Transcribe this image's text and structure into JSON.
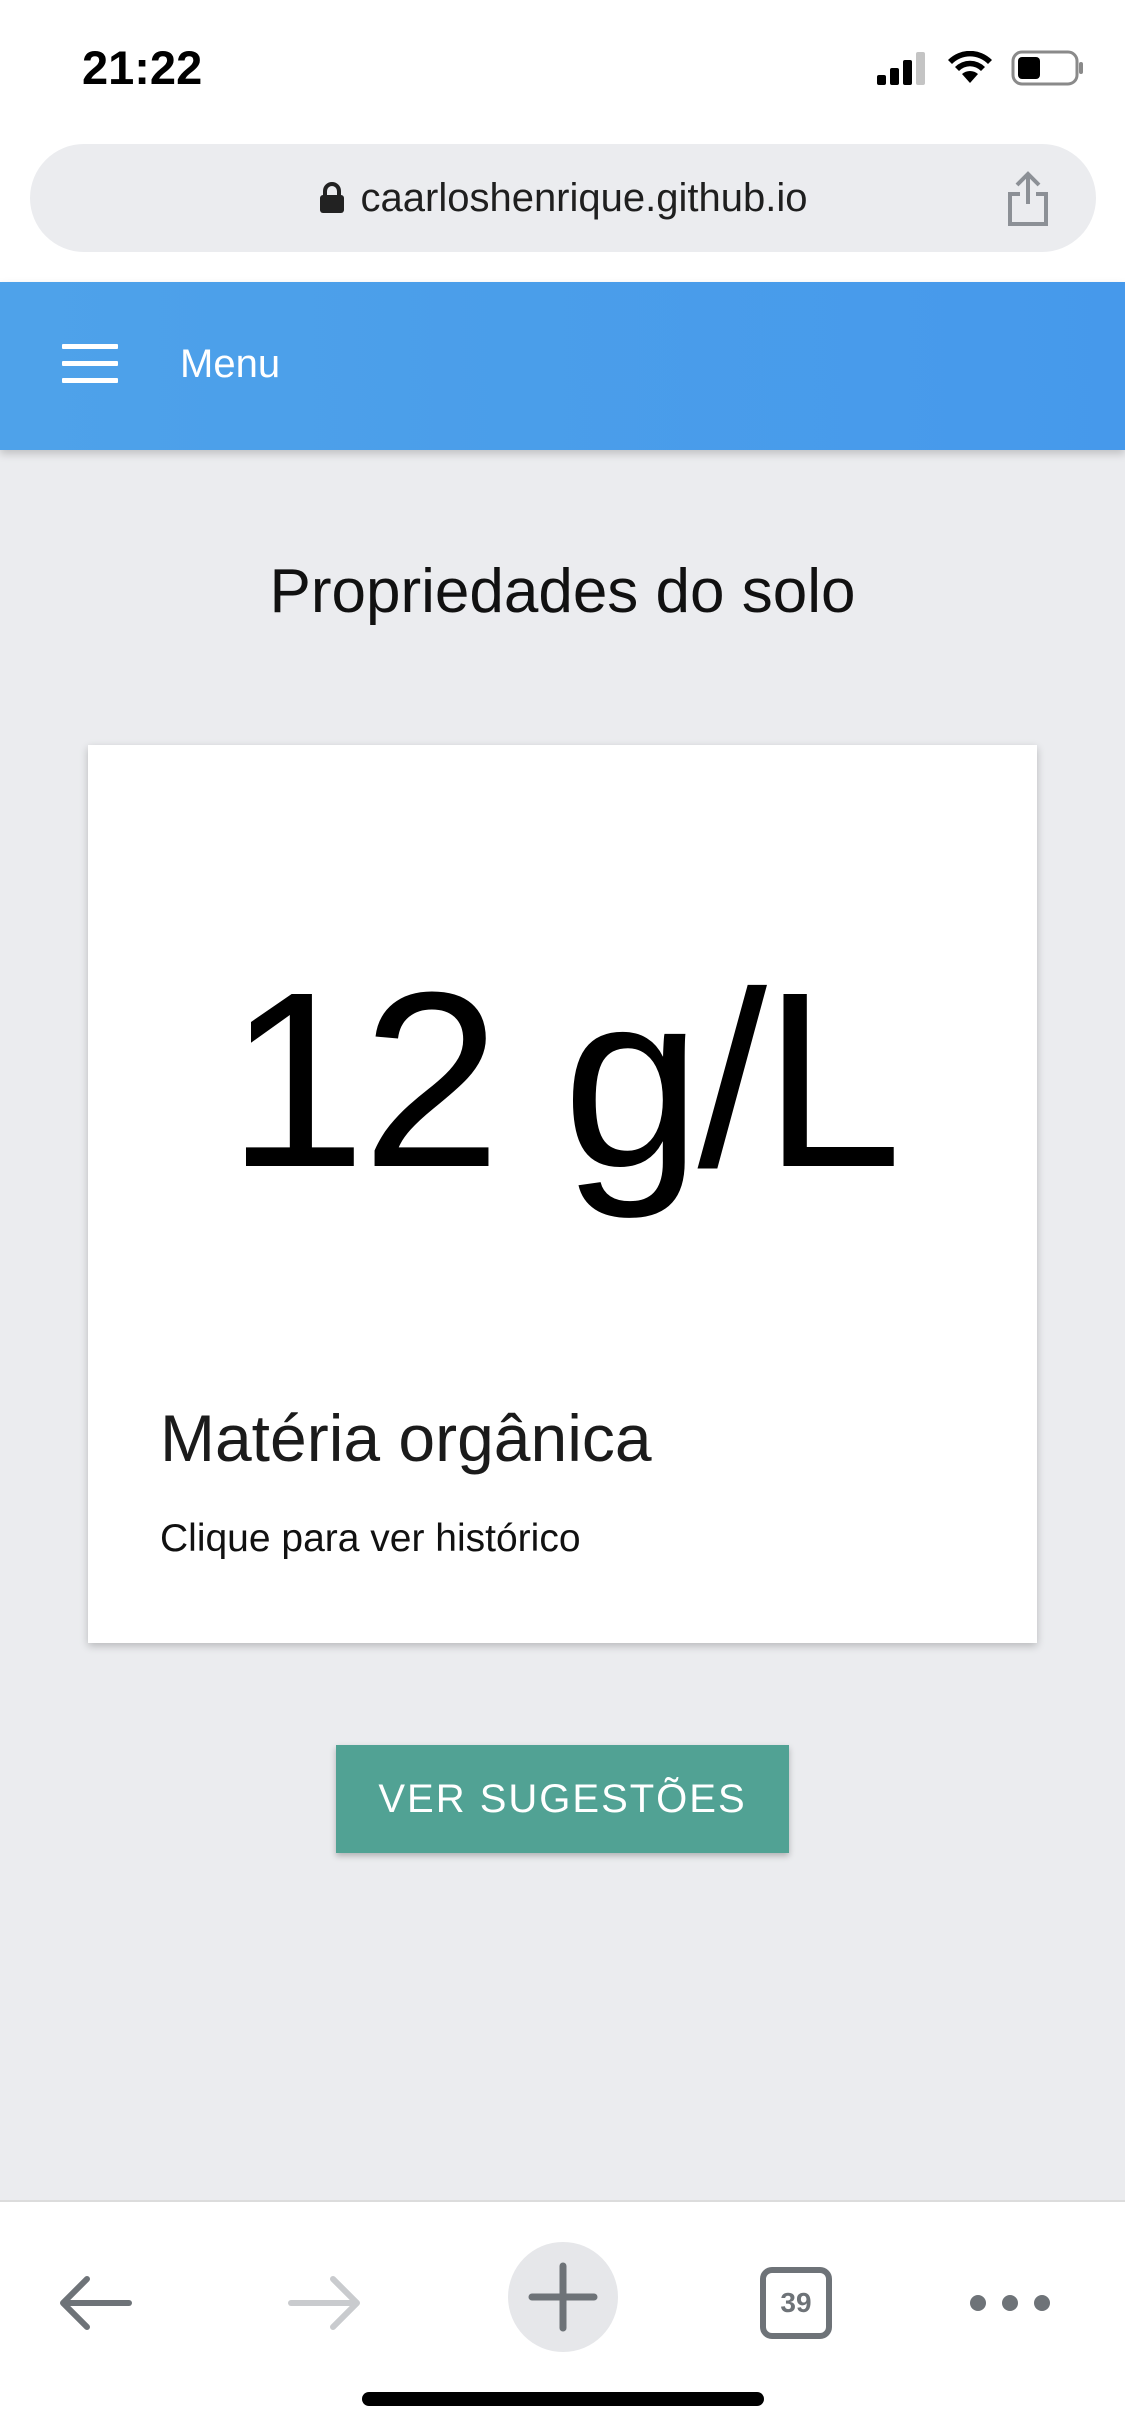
{
  "status_bar": {
    "time": "21:22",
    "icons": [
      "signal-icon",
      "wifi-icon",
      "battery-icon"
    ]
  },
  "browser": {
    "url": "caarloshenrique.github.io",
    "lock_icon": "lock-icon",
    "share_icon": "share-icon"
  },
  "app_header": {
    "menu_label": "Menu",
    "menu_icon": "hamburger-icon",
    "background_color": "#4a9eea"
  },
  "main": {
    "page_title": "Propriedades do solo",
    "card": {
      "value": "12 g/L",
      "title": "Matéria orgânica",
      "subtitle": "Clique para ver histórico"
    },
    "suggest_button_label": "VER SUGESTÕES",
    "button_color": "#51a294"
  },
  "toolbar": {
    "tab_count": "39",
    "icons": [
      "back-arrow-icon",
      "forward-arrow-icon",
      "plus-icon",
      "tabs-icon",
      "more-icon"
    ]
  }
}
